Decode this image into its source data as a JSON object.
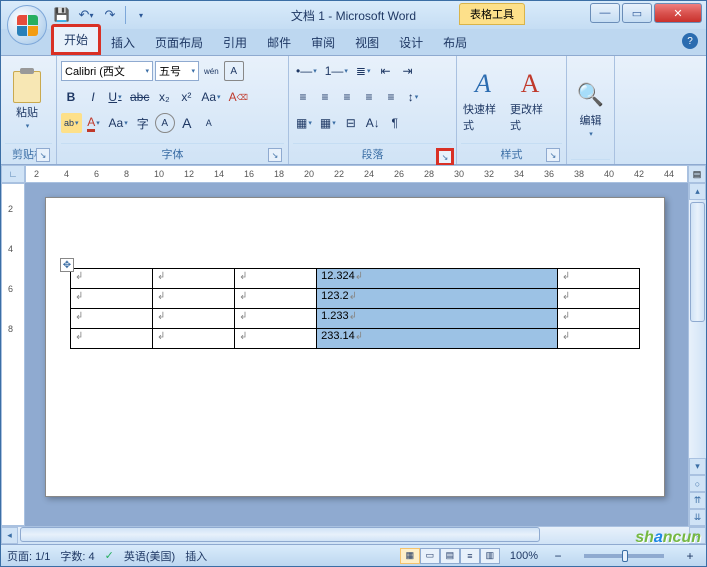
{
  "title": "文档 1 - Microsoft Word",
  "contextTab": "表格工具",
  "winControls": {
    "min": "—",
    "max": "▭",
    "close": "✕"
  },
  "qat": {
    "save": "💾",
    "undo": "↶",
    "redo": "↷"
  },
  "tabs": {
    "home": "开始",
    "insert": "插入",
    "layout": "页面布局",
    "ref": "引用",
    "mail": "邮件",
    "review": "审阅",
    "view": "视图",
    "design": "设计",
    "tlayout": "布局"
  },
  "ribbon": {
    "clipboard": {
      "paste": "粘贴",
      "label": "剪贴板"
    },
    "font": {
      "label": "字体",
      "fontName": "Calibri (西文",
      "fontSize": "五号",
      "bold": "B",
      "italic": "I",
      "underline": "U",
      "strike": "abc",
      "sub": "x₂",
      "sup": "x²",
      "highlight": "ab",
      "fontcolor": "A",
      "case": "Aa",
      "charBorder": "字",
      "circled": "A",
      "grow": "A",
      "shrink": "A",
      "clear": "⌫",
      "phonetic": "wén"
    },
    "para": {
      "label": "段落",
      "bullets": "•—",
      "numbers": "1—",
      "ml": "≣",
      "dec": "⇤",
      "inc": "⇥",
      "left": "≡",
      "center": "≡",
      "right": "≡",
      "just": "≡",
      "dist": "≡",
      "lh": "↕",
      "shade": "▦",
      "border": "▦",
      "sort": "A↓",
      "marks": "¶",
      "snap": "⊟"
    },
    "styles": {
      "label": "样式",
      "quick": "快速样式",
      "change": "更改样式"
    },
    "edit": {
      "label": "编辑",
      "find": "🔍"
    }
  },
  "ruler": {
    "ticks": [
      2,
      4,
      6,
      8,
      10,
      12,
      14,
      16,
      18,
      20,
      22,
      24,
      26,
      28,
      30,
      32,
      34,
      36,
      38,
      40,
      42,
      44
    ]
  },
  "table": {
    "rows": [
      {
        "cells": [
          "",
          "",
          "",
          "12.324",
          ""
        ]
      },
      {
        "cells": [
          "",
          "",
          "",
          "123.2",
          ""
        ]
      },
      {
        "cells": [
          "",
          "",
          "",
          "1.233",
          ""
        ]
      },
      {
        "cells": [
          "",
          "",
          "",
          "233.14",
          ""
        ]
      }
    ],
    "selCol": 3
  },
  "status": {
    "page": "页面: 1/1",
    "words": "字数: 4",
    "spell": "✓",
    "lang": "英语(美国)",
    "mode": "插入",
    "zoom": "100%"
  },
  "watermark": {
    "a": "sh",
    "b": "a",
    "c": "ncun"
  }
}
